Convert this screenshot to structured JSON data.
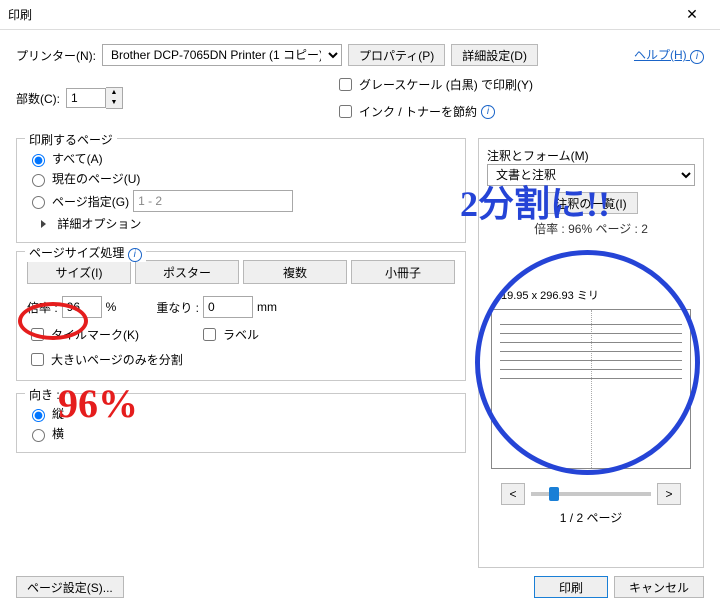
{
  "window": {
    "title": "印刷"
  },
  "top": {
    "printer_label": "プリンター(N):",
    "printer_value": "Brother DCP-7065DN Printer (1 コピー)",
    "properties_btn": "プロパティ(P)",
    "advanced_btn": "詳細設定(D)",
    "help": "ヘルプ(H)",
    "copies_label": "部数(C):",
    "copies_value": "1",
    "grayscale": "グレースケール (白黒) で印刷(Y)",
    "savetoner": "インク / トナーを節約"
  },
  "pages": {
    "legend": "印刷するページ",
    "all": "すべて(A)",
    "current": "現在のページ(U)",
    "range": "ページ指定(G)",
    "range_value": "1 - 2",
    "more": "詳細オプション"
  },
  "sizing": {
    "legend": "ページサイズ処理",
    "size_btn": "サイズ(I)",
    "poster_btn": "ポスター",
    "multi_btn": "複数",
    "booklet_btn": "小冊子",
    "scale_label": "倍率 :",
    "scale_value": "96",
    "scale_pct": "%",
    "overlap_label": "重なり :",
    "overlap_value": "0",
    "overlap_unit": "mm",
    "tilemark": "タイルマーク(K)",
    "labels": "ラベル",
    "bigonly": "大きいページのみを分割"
  },
  "orient": {
    "legend": "向き :",
    "portrait": "縦",
    "landscape": "横"
  },
  "right": {
    "legend": "注釈とフォーム(M)",
    "combo": "文書と注釈",
    "summary_btn": "注釈の一覧(I)",
    "infoline": "倍率 : 96% ページ : 2",
    "dim": "19.95 x 296.93 ミリ",
    "pager": "1 / 2 ページ",
    "prev": "<",
    "next": ">"
  },
  "footer": {
    "pagesetup": "ページ設定(S)...",
    "print": "印刷",
    "cancel": "キャンセル"
  },
  "annotations": {
    "red_text": "96%",
    "blue_text": "2分割に!!"
  }
}
